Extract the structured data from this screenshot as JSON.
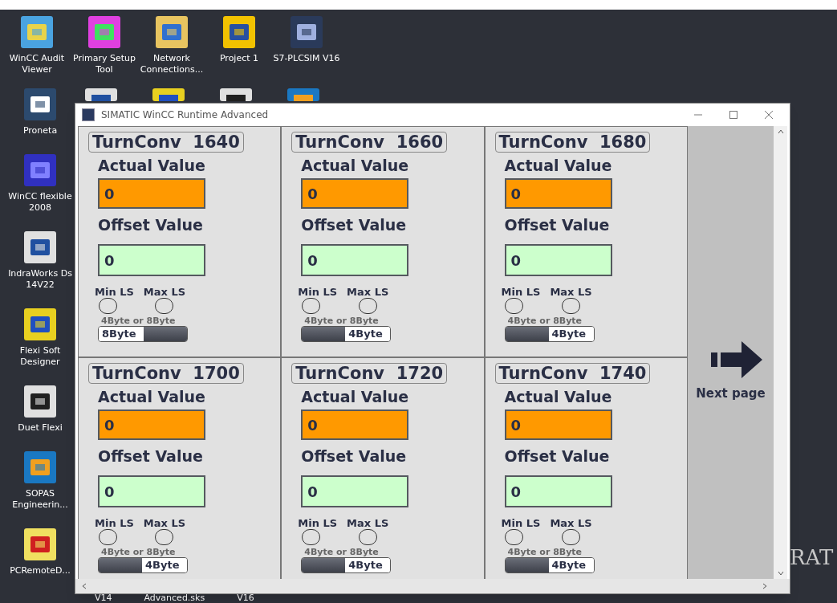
{
  "desktop": {
    "top_icons": [
      {
        "label": "WinCC Audit Viewer"
      },
      {
        "label": "Primary Setup Tool"
      },
      {
        "label": "Network Connections..."
      },
      {
        "label": "Project 1"
      },
      {
        "label": "S7-PLCSIM V16"
      }
    ],
    "left_icons": [
      {
        "label": "Proneta"
      },
      {
        "label": "WinCC flexible 2008"
      },
      {
        "label": "IndraWorks Ds 14V22"
      },
      {
        "label": "Flexi Soft Designer"
      },
      {
        "label": "Duet Flexi"
      },
      {
        "label": "SOPAS Engineerin..."
      },
      {
        "label": "PCRemoteD..."
      }
    ],
    "bottom_labels": [
      "V14",
      "Advanced.sks",
      "V16"
    ],
    "wallpaper_text": "RAT"
  },
  "window": {
    "title": "SIMATIC WinCC Runtime Advanced",
    "panels": [
      {
        "title": "TurnConv  1640",
        "actual_label": "Actual Value",
        "actual_value": "0",
        "offset_label": "Offset Value",
        "offset_value": "0",
        "min_label": "Min LS",
        "max_label": "Max LS",
        "size_label": "4Byte or 8Byte",
        "toggle": {
          "label": "8Byte",
          "on": true
        }
      },
      {
        "title": "TurnConv  1660",
        "actual_label": "Actual Value",
        "actual_value": "0",
        "offset_label": "Offset Value",
        "offset_value": "0",
        "min_label": "Min LS",
        "max_label": "Max LS",
        "size_label": "4Byte or 8Byte",
        "toggle": {
          "label": "4Byte",
          "on": false
        }
      },
      {
        "title": "TurnConv  1680",
        "actual_label": "Actual Value",
        "actual_value": "0",
        "offset_label": "Offset Value",
        "offset_value": "0",
        "min_label": "Min LS",
        "max_label": "Max LS",
        "size_label": "4Byte or 8Byte",
        "toggle": {
          "label": "4Byte",
          "on": false
        }
      },
      {
        "title": "TurnConv  1700",
        "actual_label": "Actual Value",
        "actual_value": "0",
        "offset_label": "Offset Value",
        "offset_value": "0",
        "min_label": "Min LS",
        "max_label": "Max LS",
        "size_label": "4Byte or 8Byte",
        "toggle": {
          "label": "4Byte",
          "on": false
        }
      },
      {
        "title": "TurnConv  1720",
        "actual_label": "Actual Value",
        "actual_value": "0",
        "offset_label": "Offset Value",
        "offset_value": "0",
        "min_label": "Min LS",
        "max_label": "Max LS",
        "size_label": "4Byte or 8Byte",
        "toggle": {
          "label": "4Byte",
          "on": false
        }
      },
      {
        "title": "TurnConv  1740",
        "actual_label": "Actual Value",
        "actual_value": "0",
        "offset_label": "Offset Value",
        "offset_value": "0",
        "min_label": "Min LS",
        "max_label": "Max LS",
        "size_label": "4Byte or 8Byte",
        "toggle": {
          "label": "4Byte",
          "on": false
        }
      }
    ],
    "next_page": "Next page"
  }
}
